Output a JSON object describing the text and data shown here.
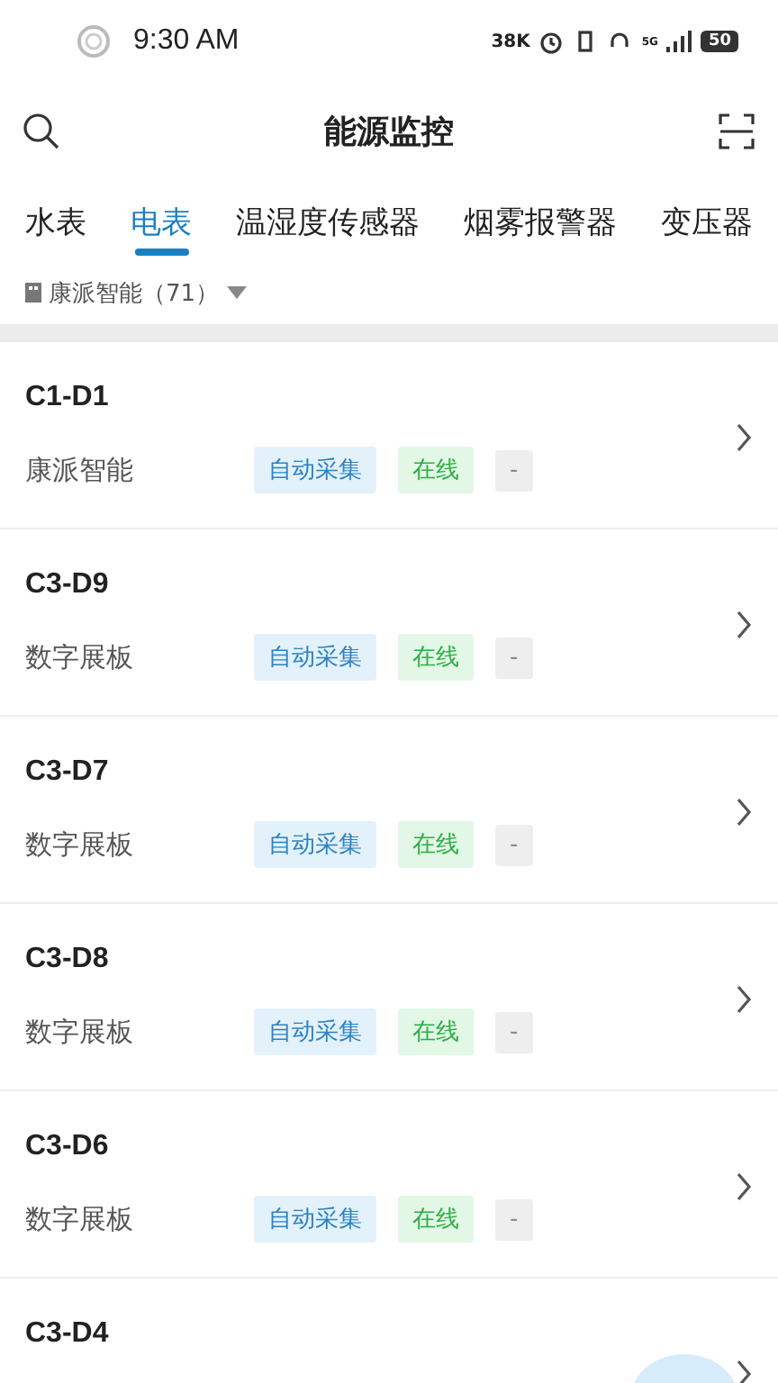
{
  "status_bar": {
    "time": "9:30 AM",
    "net_speed": "38K",
    "network": "5G",
    "battery": "50"
  },
  "header": {
    "title": "能源监控"
  },
  "tabs": [
    {
      "label": "水表",
      "selected": false
    },
    {
      "label": "电表",
      "selected": true
    },
    {
      "label": "温湿度传感器",
      "selected": false
    },
    {
      "label": "烟雾报警器",
      "selected": false
    },
    {
      "label": "变压器",
      "selected": false
    }
  ],
  "filter": {
    "label": "康派智能（71）"
  },
  "devices": [
    {
      "name": "C1-D1",
      "group": "康派智能",
      "tags": [
        {
          "kind": "mode",
          "text": "自动采集"
        },
        {
          "kind": "status",
          "text": "在线"
        },
        {
          "kind": "extra",
          "text": "-"
        }
      ]
    },
    {
      "name": "C3-D9",
      "group": "数字展板",
      "tags": [
        {
          "kind": "mode",
          "text": "自动采集"
        },
        {
          "kind": "status",
          "text": "在线"
        },
        {
          "kind": "extra",
          "text": "-"
        }
      ]
    },
    {
      "name": "C3-D7",
      "group": "数字展板",
      "tags": [
        {
          "kind": "mode",
          "text": "自动采集"
        },
        {
          "kind": "status",
          "text": "在线"
        },
        {
          "kind": "extra",
          "text": "-"
        }
      ]
    },
    {
      "name": "C3-D8",
      "group": "数字展板",
      "tags": [
        {
          "kind": "mode",
          "text": "自动采集"
        },
        {
          "kind": "status",
          "text": "在线"
        },
        {
          "kind": "extra",
          "text": "-"
        }
      ]
    },
    {
      "name": "C3-D6",
      "group": "数字展板",
      "tags": [
        {
          "kind": "mode",
          "text": "自动采集"
        },
        {
          "kind": "status",
          "text": "在线"
        },
        {
          "kind": "extra",
          "text": "-"
        }
      ]
    },
    {
      "name": "C3-D4"
    }
  ]
}
